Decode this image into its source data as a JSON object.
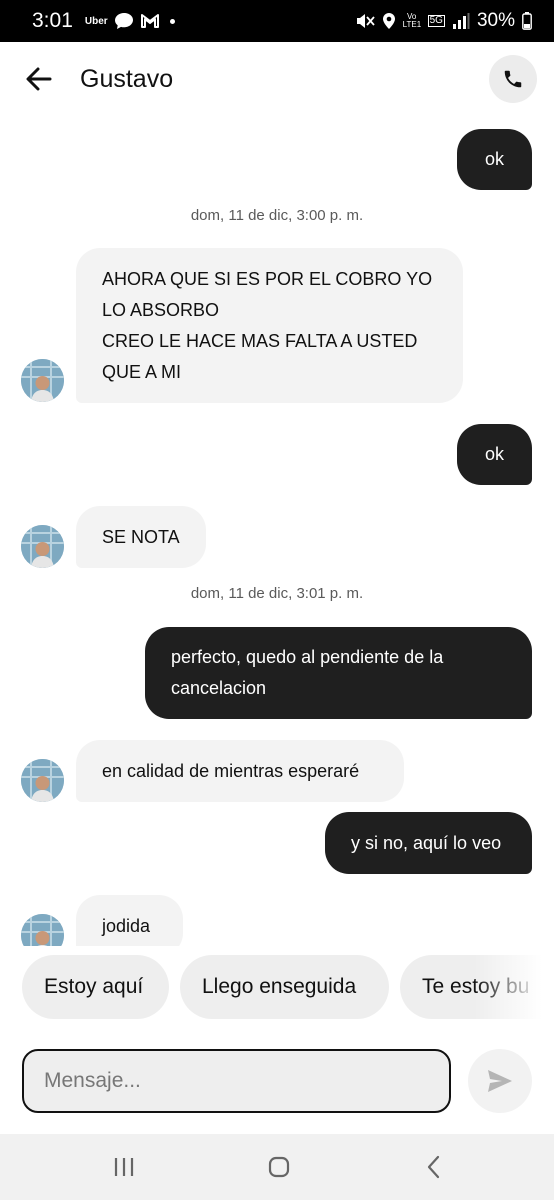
{
  "status_bar": {
    "time": "3:01",
    "app_label": "Uber",
    "volte_label": "Vo LTE1",
    "network_label": "5G",
    "battery": "30%",
    "icons": [
      "chat-bubble-icon",
      "gmail-icon",
      "mute-icon",
      "location-icon",
      "signal-icon",
      "battery-icon"
    ]
  },
  "header": {
    "contact_name": "Gustavo",
    "back_icon": "arrow-left-icon",
    "call_icon": "phone-icon"
  },
  "messages": [
    {
      "direction": "outgoing",
      "text": "ok"
    },
    {
      "type": "timestamp",
      "text": "dom, 11 de dic, 3:00 p. m."
    },
    {
      "direction": "incoming",
      "lines": [
        "AHORA QUE SI ES POR EL COBRO YO",
        "LO ABSORBO",
        "CREO LE HACE MAS FALTA A USTED",
        "QUE A MI"
      ]
    },
    {
      "direction": "outgoing",
      "text": "ok"
    },
    {
      "direction": "incoming",
      "text": "SE NOTA"
    },
    {
      "type": "timestamp",
      "text": "dom, 11 de dic, 3:01 p. m."
    },
    {
      "direction": "outgoing",
      "lines": [
        "perfecto, quedo al pendiente de la",
        "cancelacion"
      ]
    },
    {
      "direction": "incoming",
      "text": "en calidad de mientras esperaré"
    },
    {
      "direction": "outgoing",
      "text": "y si no, aquí lo veo"
    },
    {
      "direction": "incoming",
      "text": "jodida"
    }
  ],
  "quick_replies": [
    "Estoy aquí",
    "Llego enseguida",
    "Te estoy bu"
  ],
  "composer": {
    "placeholder": "Mensaje...",
    "value": "",
    "send_icon": "send-icon"
  },
  "nav_bar": {
    "icons": [
      "recent-apps-icon",
      "home-icon",
      "back-nav-icon"
    ]
  },
  "colors": {
    "outgoing_bubble": "#1f1f1f",
    "incoming_bubble": "#f3f3f3",
    "chip_bg": "#eeeeee",
    "status_bar": "#000000"
  }
}
